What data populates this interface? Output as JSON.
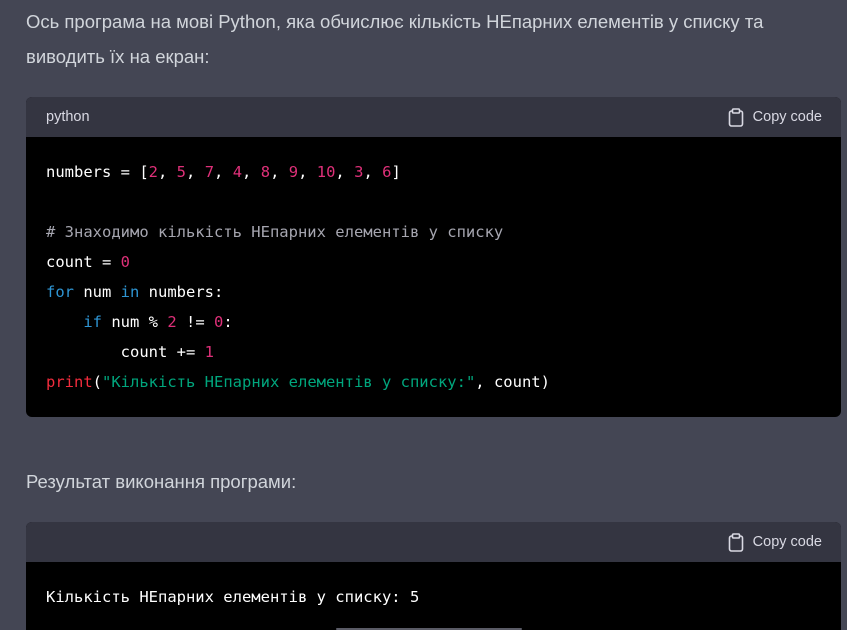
{
  "intro_text": "Ось програма на мові Python, яка обчислює кількість НЕпарних елементів у списку та виводить їх на екран:",
  "result_text": "Результат виконання програми:",
  "colors": {
    "background": "#444654",
    "code_background": "#000000",
    "code_header": "#343541",
    "number": "#df3079",
    "keyword": "#2e95d3",
    "builtin": "#f22c3d",
    "string": "#00a67d",
    "comment": "#a6a6b0"
  },
  "code_block_1": {
    "language": "python",
    "copy_label": "Copy code",
    "copy_icon": "clipboard-icon",
    "lines": [
      [
        {
          "t": "numbers = [",
          "c": "plain"
        },
        {
          "t": "2",
          "c": "num"
        },
        {
          "t": ", ",
          "c": "plain"
        },
        {
          "t": "5",
          "c": "num"
        },
        {
          "t": ", ",
          "c": "plain"
        },
        {
          "t": "7",
          "c": "num"
        },
        {
          "t": ", ",
          "c": "plain"
        },
        {
          "t": "4",
          "c": "num"
        },
        {
          "t": ", ",
          "c": "plain"
        },
        {
          "t": "8",
          "c": "num"
        },
        {
          "t": ", ",
          "c": "plain"
        },
        {
          "t": "9",
          "c": "num"
        },
        {
          "t": ", ",
          "c": "plain"
        },
        {
          "t": "10",
          "c": "num"
        },
        {
          "t": ", ",
          "c": "plain"
        },
        {
          "t": "3",
          "c": "num"
        },
        {
          "t": ", ",
          "c": "plain"
        },
        {
          "t": "6",
          "c": "num"
        },
        {
          "t": "]",
          "c": "plain"
        }
      ],
      [],
      [
        {
          "t": "# Знаходимо кількість НЕпарних елементів у списку",
          "c": "cmt"
        }
      ],
      [
        {
          "t": "count = ",
          "c": "plain"
        },
        {
          "t": "0",
          "c": "num"
        }
      ],
      [
        {
          "t": "for",
          "c": "kw"
        },
        {
          "t": " num ",
          "c": "plain"
        },
        {
          "t": "in",
          "c": "kw"
        },
        {
          "t": " numbers:",
          "c": "plain"
        }
      ],
      [
        {
          "t": "    ",
          "c": "plain"
        },
        {
          "t": "if",
          "c": "kw"
        },
        {
          "t": " num % ",
          "c": "plain"
        },
        {
          "t": "2",
          "c": "num"
        },
        {
          "t": " != ",
          "c": "plain"
        },
        {
          "t": "0",
          "c": "num"
        },
        {
          "t": ":",
          "c": "plain"
        }
      ],
      [
        {
          "t": "        count += ",
          "c": "plain"
        },
        {
          "t": "1",
          "c": "num"
        }
      ],
      [
        {
          "t": "print",
          "c": "fn"
        },
        {
          "t": "(",
          "c": "plain"
        },
        {
          "t": "\"Кількість НЕпарних елементів у списку:\"",
          "c": "str"
        },
        {
          "t": ", count)",
          "c": "plain"
        }
      ]
    ]
  },
  "code_block_2": {
    "copy_label": "Copy code",
    "copy_icon": "clipboard-icon",
    "lines": [
      [
        {
          "t": "Кількість НЕпарних елементів у списку: 5",
          "c": "plain"
        }
      ]
    ]
  }
}
